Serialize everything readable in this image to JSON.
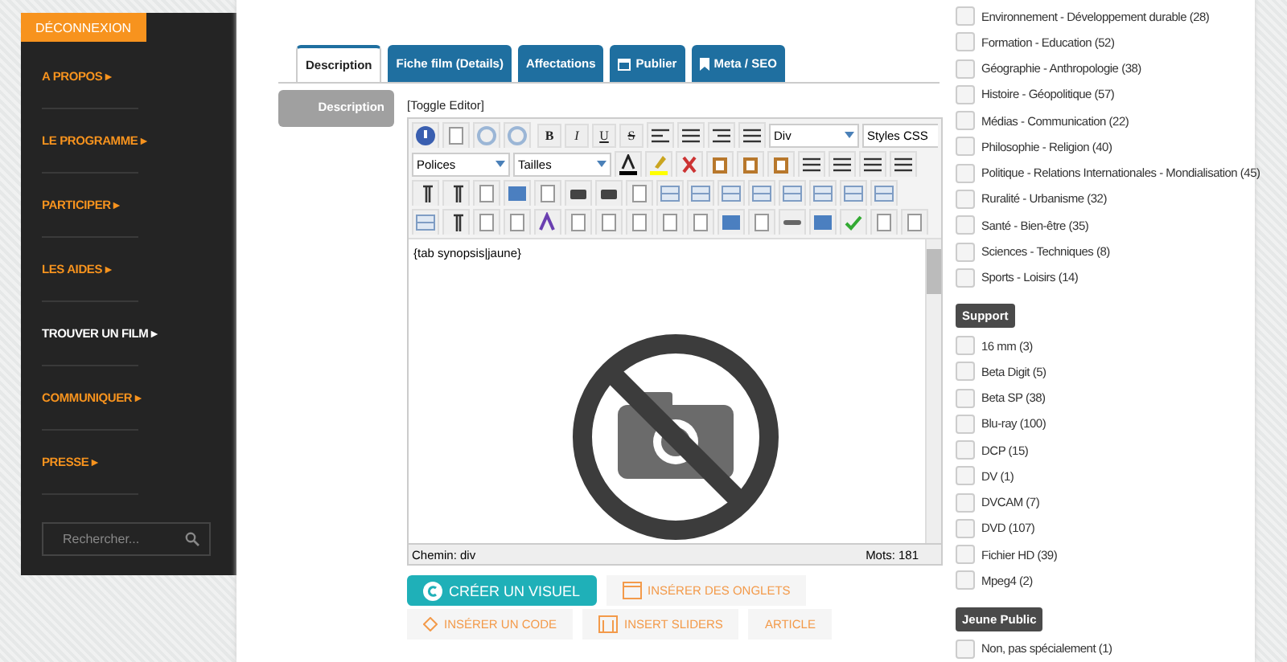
{
  "sidebar": {
    "logout_button": "DÉCONNEXION",
    "items": [
      {
        "label": "A PROPOS",
        "arrow": "▸",
        "selected": false
      },
      {
        "label": "LE PROGRAMME",
        "arrow": "▸",
        "selected": false
      },
      {
        "label": "PARTICIPER",
        "arrow": "▸",
        "selected": false
      },
      {
        "label": "LES AIDES",
        "arrow": "▸",
        "selected": false
      },
      {
        "label": "TROUVER UN FILM",
        "arrow": "▸",
        "selected": true
      },
      {
        "label": "COMMUNIQUER",
        "arrow": "▸",
        "selected": false
      },
      {
        "label": "PRESSE",
        "arrow": "▸",
        "selected": false
      }
    ],
    "search": {
      "placeholder": "Rechercher..."
    }
  },
  "tabs": [
    {
      "label": "Description",
      "kind": "plain",
      "selected": true
    },
    {
      "label": "Fiche film (Details)",
      "kind": "plain",
      "selected": false
    },
    {
      "label": "Affectations",
      "kind": "plain",
      "selected": false
    },
    {
      "label": "Publier",
      "kind": "calendar",
      "selected": false
    },
    {
      "label": "Meta / SEO",
      "kind": "bookmark",
      "selected": false
    }
  ],
  "description_label": "Description",
  "toggle_editor": "[Toggle Editor]",
  "editor": {
    "toolbar": {
      "bold": "B",
      "italic": "I",
      "underline": "U",
      "strike": "S",
      "format": "Div",
      "styles": "Styles CSS",
      "fonts": "Polices",
      "sizes": "Tailles"
    },
    "content": "{tab synopsis|jaune}",
    "path": "Chemin: div",
    "word_count": "Mots: 181"
  },
  "buttons": [
    {
      "label": "CRÉER UN VISUEL",
      "kind": "primary"
    },
    {
      "label": "INSÉRER DES ONGLETS",
      "kind": "tabs"
    },
    {
      "label": "INSÉRER UN CODE",
      "kind": "code"
    },
    {
      "label": "INSERT SLIDERS",
      "kind": "sliders"
    },
    {
      "label": "ARTICLE",
      "kind": "plain"
    }
  ],
  "filter_groups": [
    {
      "items": [
        {
          "label": "Environnement - Développement durable (28)",
          "checked": false
        },
        {
          "label": "Formation - Education (52)",
          "checked": false
        },
        {
          "label": "Géographie - Anthropologie (38)",
          "checked": false
        },
        {
          "label": "Histoire - Géopolitique (57)",
          "checked": false
        },
        {
          "label": "Médias - Communication (22)",
          "checked": false
        },
        {
          "label": "Philosophie - Religion (40)",
          "checked": false
        },
        {
          "label": "Politique - Relations Internationales - Mondialisation (45)",
          "checked": false
        },
        {
          "label": "Ruralité - Urbanisme (32)",
          "checked": false
        },
        {
          "label": "Santé - Bien-être (35)",
          "checked": false
        },
        {
          "label": "Sciences - Techniques (8)",
          "checked": false
        },
        {
          "label": "Sports - Loisirs (14)",
          "checked": false
        }
      ]
    },
    {
      "heading": "Support",
      "items": [
        {
          "label": "16 mm (3)",
          "checked": false
        },
        {
          "label": "Beta Digit (5)",
          "checked": false
        },
        {
          "label": "Beta SP (38)",
          "checked": false
        },
        {
          "label": "Blu-ray (100)",
          "checked": false
        },
        {
          "label": "DCP (15)",
          "checked": false
        },
        {
          "label": "DV (1)",
          "checked": false
        },
        {
          "label": "DVCAM (7)",
          "checked": false
        },
        {
          "label": "DVD (107)",
          "checked": false
        },
        {
          "label": "Fichier HD (39)",
          "checked": false
        },
        {
          "label": "Mpeg4 (2)",
          "checked": false
        }
      ]
    },
    {
      "heading": "Jeune Public",
      "items": [
        {
          "label": "Non, pas spécialement (1)",
          "checked": false
        }
      ]
    }
  ]
}
